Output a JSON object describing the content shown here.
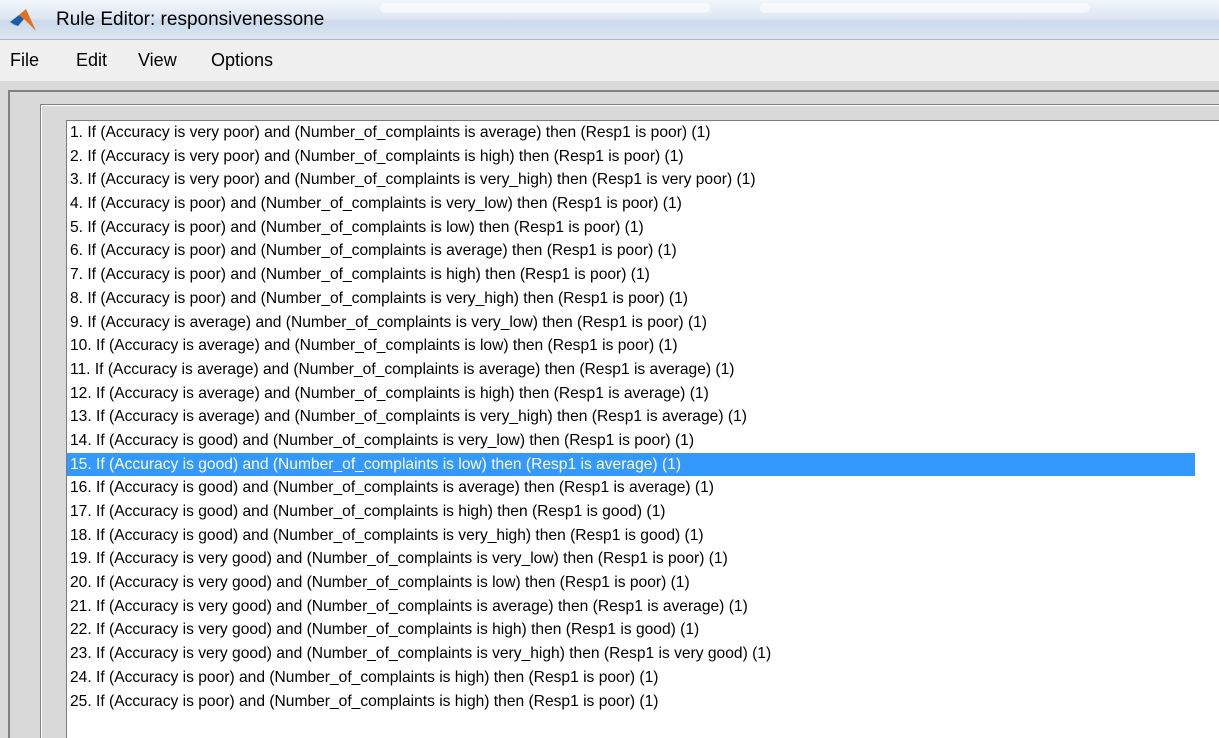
{
  "window": {
    "title": "Rule Editor: responsivenessone",
    "app_icon": "matlab-membrane-icon",
    "colors": {
      "selection": "#3399ff",
      "panel": "#d9d9d9"
    }
  },
  "menu": {
    "items": [
      "File",
      "Edit",
      "View",
      "Options"
    ]
  },
  "rules": {
    "selected_index": 14,
    "items": [
      "1. If (Accuracy is very poor) and (Number_of_complaints is average) then (Resp1 is poor) (1)",
      "2. If (Accuracy is very poor) and (Number_of_complaints is high) then (Resp1 is poor) (1)",
      "3. If (Accuracy is very poor) and (Number_of_complaints is very_high) then (Resp1 is very poor) (1)",
      "4. If (Accuracy is poor) and (Number_of_complaints is very_low) then (Resp1 is poor) (1)",
      "5. If (Accuracy is poor) and (Number_of_complaints is low) then (Resp1 is poor) (1)",
      "6. If (Accuracy is poor) and (Number_of_complaints is average) then (Resp1 is poor) (1)",
      "7. If (Accuracy is poor) and (Number_of_complaints is high) then (Resp1 is poor) (1)",
      "8. If (Accuracy is poor) and (Number_of_complaints is very_high) then (Resp1 is poor) (1)",
      "9. If (Accuracy is average) and (Number_of_complaints is very_low) then (Resp1 is poor) (1)",
      "10. If (Accuracy is average) and (Number_of_complaints is low) then (Resp1 is poor) (1)",
      "11. If (Accuracy is average) and (Number_of_complaints is average) then (Resp1 is average) (1)",
      "12. If (Accuracy is average) and (Number_of_complaints is high) then (Resp1 is average) (1)",
      "13. If (Accuracy is average) and (Number_of_complaints is very_high) then (Resp1 is average) (1)",
      "14. If (Accuracy is good) and (Number_of_complaints is very_low) then (Resp1 is poor) (1)",
      "15. If (Accuracy is good) and (Number_of_complaints is low) then (Resp1 is average) (1)",
      "16. If (Accuracy is good) and (Number_of_complaints is average) then (Resp1 is average) (1)",
      "17. If (Accuracy is good) and (Number_of_complaints is high) then (Resp1 is good) (1)",
      "18. If (Accuracy is good) and (Number_of_complaints is very_high) then (Resp1 is good) (1)",
      "19. If (Accuracy is very good) and (Number_of_complaints is very_low) then (Resp1 is poor) (1)",
      "20. If (Accuracy is very good) and (Number_of_complaints is low) then (Resp1 is poor) (1)",
      "21. If (Accuracy is very good) and (Number_of_complaints is average) then (Resp1 is average) (1)",
      "22. If (Accuracy is very good) and (Number_of_complaints is high) then (Resp1 is good) (1)",
      "23. If (Accuracy is very good) and (Number_of_complaints is very_high) then (Resp1 is very good) (1)",
      "24. If (Accuracy is poor) and (Number_of_complaints is high) then (Resp1 is poor) (1)",
      "25. If (Accuracy is poor) and (Number_of_complaints is high) then (Resp1 is poor) (1)"
    ]
  }
}
